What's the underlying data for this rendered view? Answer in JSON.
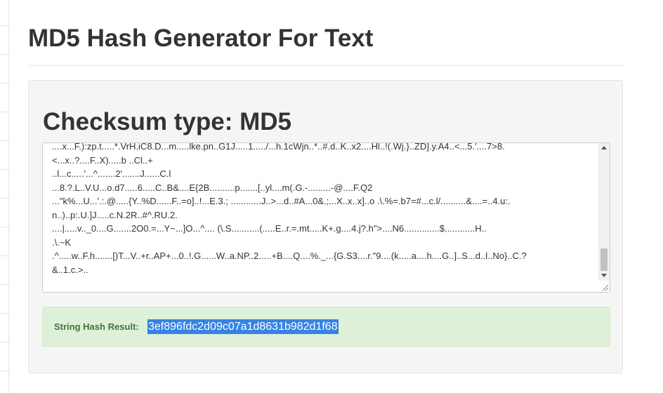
{
  "page": {
    "title": "MD5 Hash Generator For Text"
  },
  "panel": {
    "heading": "Checksum type: MD5",
    "input_text": "....x...F.):zp.t.....*.VrH.iC8.D...m.....lke.pn..G1J.....1...../...h.1cWjn..*..#.d..K..x2....Hl..!(.Wj.}..ZD].y.A4..<...5.'....7>8.\n<...x..?....F..X).....b ..Cl..+\n..l...c.....'...^.......2'.......J......C.l\n...8.?.L..V.U...o.d7.....6.....C..B&....E{2B..........p.......[..yl....m(.G.-.........-@....F.Q2\n...\"k%...U...'.:.@.....{Y..%D......F..=o]..!...E.3.; ............J..>...d..#A...0&.;...X..x..x]..o .\\.%=.b7=#...c.l/..........&....=..4.u:.\nn..)..p:.U.]J.....c.N.2R..#^.RU.2.\n....|.....v.._0....G.......2O0.=...Y~...]O...^.... (\\.S...........(.....E..r.=.mt.....K+.g....4.j?.h\">....N6..............$............H..\n.\\.~K\n.^.....w..F.h.......[)T...V..+r..AP+...0..!.G......W..a.NP..2.....+B....Q....%._...{G.S3....r.\"9....(k.....a....h....G..]..S...d..l..No}..C.?\n&..1.c.>.."
  },
  "result": {
    "label": "String Hash Result:",
    "hash": "3ef896fdc2d09c07a1d8631b982d1f68"
  },
  "colors": {
    "result_background": "#dff0d8",
    "result_text": "#3c763d",
    "selection_highlight": "#3583e4"
  }
}
